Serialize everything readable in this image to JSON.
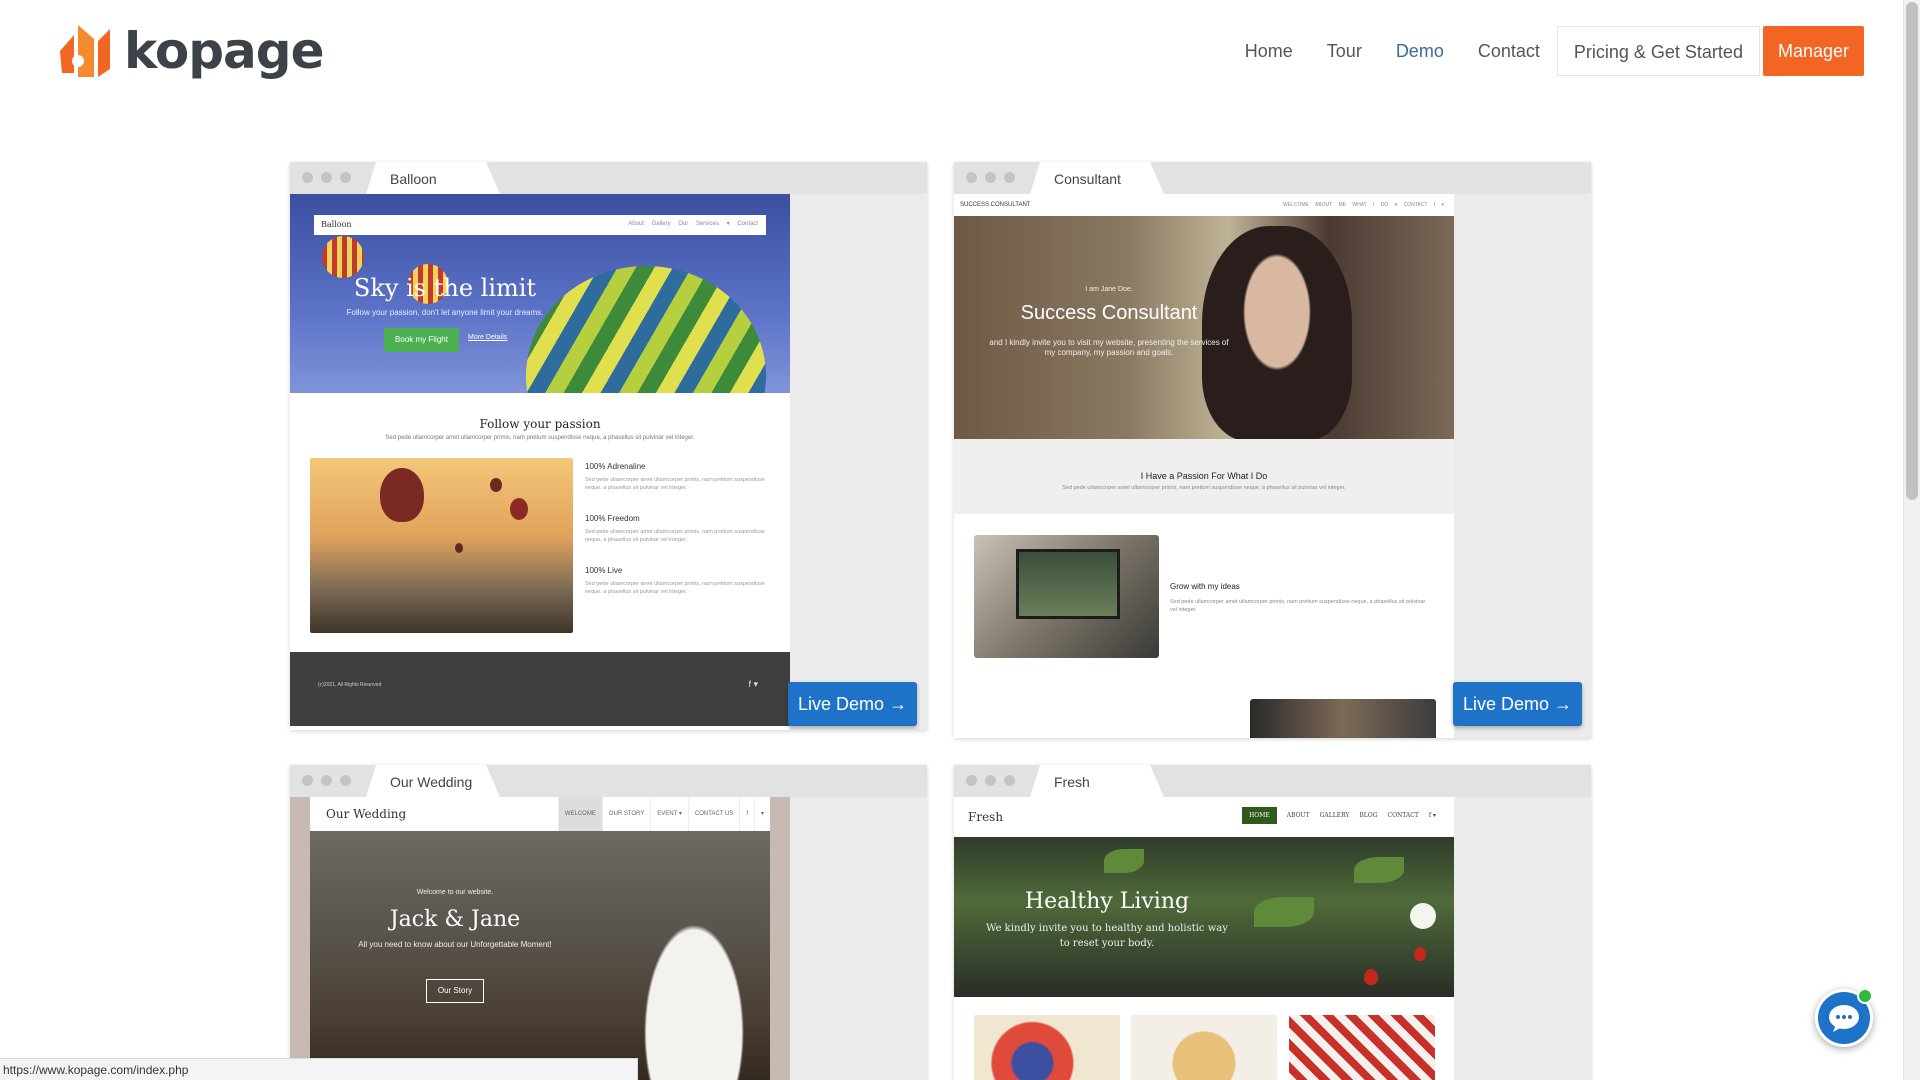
{
  "brand": {
    "name": "kopage",
    "accent": "#f26522"
  },
  "nav": {
    "items": [
      {
        "label": "Home"
      },
      {
        "label": "Tour"
      },
      {
        "label": "Demo"
      },
      {
        "label": "Contact"
      },
      {
        "label": "Pricing & Get Started"
      },
      {
        "label": "Manager"
      }
    ],
    "active": "Demo"
  },
  "demos": [
    {
      "tab": "Balloon",
      "live_demo": "Live Demo →",
      "preview": {
        "brand": "Balloon",
        "links": "About Gallery Our Services ▾ Contact",
        "hero_title": "Sky is the limit",
        "hero_sub": "Follow your passion, don't let anyone limit your dreams.",
        "cta": "Book my Flight",
        "more": "More Details",
        "section_title": "Follow your passion",
        "section_text": "Sed pede ullamcorper amet ullamcorper primis, nam pretium suspendisse neque, a phasellus sit pulvinar vel integer.",
        "features": [
          {
            "title": "100% Adrenaline",
            "text": "Sed pede ullamcorper amet ullamcorper primis, nam pretium suspendisse neque, a phasellus sit pulvinar vel integer."
          },
          {
            "title": "100% Freedom",
            "text": "Sed pede ullamcorper amet ullamcorper primis, nam pretium suspendisse neque, a phasellus sit pulvinar vel integer."
          },
          {
            "title": "100% Live",
            "text": "Sed pede ullamcorper amet ullamcorper primis, nam pretium suspendisse neque, a phasellus sit pulvinar vel integer."
          }
        ],
        "footer_copy": "(c)2021, All Rights Reserved",
        "footer_social": "f ▾"
      }
    },
    {
      "tab": "Consultant",
      "live_demo": "Live Demo →",
      "preview": {
        "brand": "SUCCESS CONSULTANT",
        "links": "WELCOME ABOUT ME WHAT I DO ▾ CONTACT f ▾",
        "hero_small": "I am Jane Doe.",
        "hero_title": "Success Consultant",
        "hero_desc": "and I kindly invite you to visit my website, presenting the services of my company, my passion and goals.",
        "band_title": "I Have a Passion For What I Do",
        "band_text": "Sed pede ullamcorper amet ullamcorper primis, nam pretium suspendisse neque, a phasellus sit pulvinar vel integer.",
        "grow_title": "Grow with my ideas",
        "grow_text": "Sed pede ullamcorper amet ullamcorper primis, nam pretium suspendisse neque, a phasellus sit pulvinar vel integer."
      }
    },
    {
      "tab": "Our Wedding",
      "preview": {
        "brand": "Our Wedding",
        "links": [
          "WELCOME",
          "OUR STORY",
          "EVENT ▾",
          "CONTACT US",
          "f",
          "▾"
        ],
        "hero_small": "Welcome to our website.",
        "hero_title": "Jack & Jane",
        "hero_sub": "All you need to know about our Unforgettable Moment!",
        "cta": "Our Story"
      }
    },
    {
      "tab": "Fresh",
      "preview": {
        "brand": "Fresh",
        "links": [
          "HOME",
          "ABOUT",
          "GALLERY",
          "BLOG",
          "CONTACT",
          "f ▾"
        ],
        "hero_title": "Healthy Living",
        "hero_sub": "We kindly invite you to healthy and holistic way to reset your body."
      }
    }
  ],
  "status_url": "https://www.kopage.com/index.php",
  "chat": {
    "icon": "chat-bubble-icon",
    "status": "online"
  }
}
